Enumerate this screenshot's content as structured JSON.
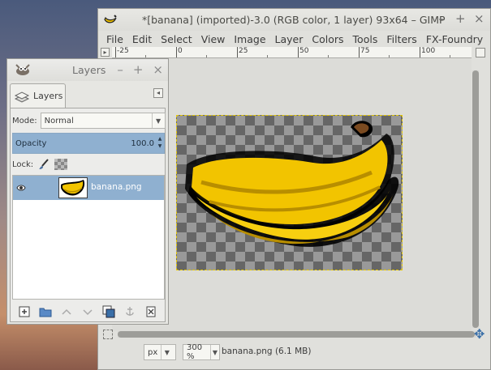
{
  "main_window": {
    "title": "*[banana] (imported)-3.0 (RGB color, 1 layer) 93x64 – GIMP",
    "controls": {
      "minimize": "–",
      "maximize": "+",
      "close": "×"
    },
    "menu": [
      "File",
      "Edit",
      "Select",
      "View",
      "Image",
      "Layer",
      "Colors",
      "Tools",
      "Filters",
      "FX-Foundry"
    ],
    "ruler_labels": [
      "-25",
      "0",
      "25",
      "50",
      "75",
      "100"
    ],
    "status": {
      "unit": "px",
      "zoom": "300 %",
      "info": "banana.png (6.1 MB)"
    }
  },
  "layers_dock": {
    "title": "Layers",
    "controls": {
      "minimize": "–",
      "maximize": "+",
      "close": "×"
    },
    "tab_label": "Layers",
    "mode_label": "Mode:",
    "mode_value": "Normal",
    "opacity_label": "Opacity",
    "opacity_value": "100.0",
    "lock_label": "Lock:",
    "layers": [
      {
        "name": "banana.png",
        "visible": true,
        "selected": true
      }
    ],
    "toolbar_icons": [
      "new-layer-icon",
      "new-layer-group-icon",
      "raise-layer-icon",
      "lower-layer-icon",
      "duplicate-layer-icon",
      "anchor-layer-icon",
      "delete-layer-icon"
    ]
  },
  "colors": {
    "selection": "#8fb0d0",
    "banana_yellow": "#f2c400",
    "banana_shadow": "#b88e00",
    "selection_border": "#e6c800"
  }
}
